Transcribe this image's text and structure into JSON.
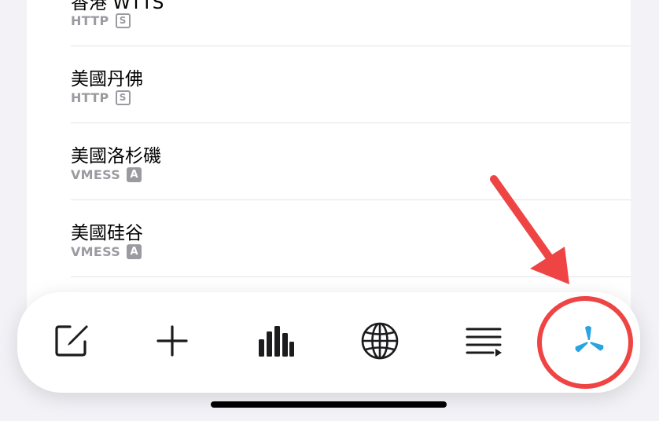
{
  "servers": [
    {
      "name": "香港 WTTS",
      "protocol": "HTTP",
      "badge": "S",
      "badge_style": "outline"
    },
    {
      "name": "美國丹佛",
      "protocol": "HTTP",
      "badge": "S",
      "badge_style": "outline"
    },
    {
      "name": "美國洛杉磯",
      "protocol": "VMESS",
      "badge": "A",
      "badge_style": "filled"
    },
    {
      "name": "美國硅谷",
      "protocol": "VMESS",
      "badge": "A",
      "badge_style": "filled"
    }
  ],
  "toolbar": {
    "items": [
      {
        "icon": "edit-icon"
      },
      {
        "icon": "plus-icon"
      },
      {
        "icon": "bar-chart-icon"
      },
      {
        "icon": "globe-icon"
      },
      {
        "icon": "list-play-icon"
      },
      {
        "icon": "app-logo-icon",
        "highlighted": true
      }
    ]
  },
  "colors": {
    "accent": "#2aa4e0",
    "annotation": "#ef4444",
    "badge_gray": "#9a9aa0",
    "separator": "#e3e3e8"
  }
}
